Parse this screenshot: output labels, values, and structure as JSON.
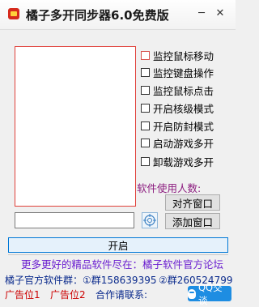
{
  "window": {
    "title": "橘子多开同步器6.0免费版",
    "minimize_glyph": "─",
    "close_glyph": "✕"
  },
  "options": [
    {
      "label": "监控鼠标移动",
      "checked": false
    },
    {
      "label": "监控键盘操作",
      "checked": false
    },
    {
      "label": "监控鼠标点击",
      "checked": false
    },
    {
      "label": "开启核级模式",
      "checked": false
    },
    {
      "label": "开启防封模式",
      "checked": false
    },
    {
      "label": "启动游戏多开",
      "checked": false
    },
    {
      "label": "卸载游戏多开",
      "checked": false
    }
  ],
  "users_label": "软件使用人数:",
  "buttons": {
    "align": "对齐窗口",
    "add": "添加窗口",
    "start": "开启"
  },
  "window_input": {
    "value": ""
  },
  "footer": {
    "more_link": "更多更好的精品软件尽在：橘子软件官方论坛",
    "official_group": "橘子官方软件群：①群158639395",
    "group2": "②群260524799",
    "ad1": "广告位1",
    "ad2": "广告位2",
    "contact": "合作请联系:",
    "qq_button": "QQ交谈"
  },
  "colors": {
    "log_border": "#e0403a",
    "users_label": "#8b1a7e",
    "link": "#6b1fd0",
    "group_text": "#0a2a8c",
    "ad_text": "#cc0000",
    "qq_blue": "#1e8de2"
  }
}
